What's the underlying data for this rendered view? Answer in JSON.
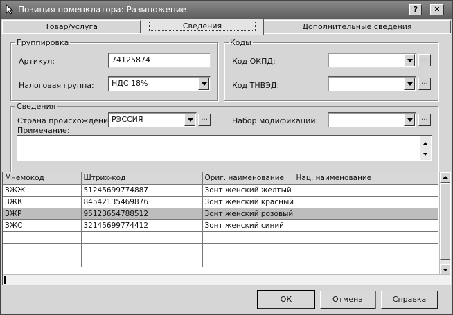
{
  "window": {
    "title": "Позиция номенклатора: Размножение",
    "help_button": "?",
    "close_button": "✕"
  },
  "tabs": [
    {
      "label": "Товар/услуга",
      "active": false
    },
    {
      "label": "Сведения",
      "active": true
    },
    {
      "label": "Дополнительные сведения",
      "active": false
    }
  ],
  "grouping": {
    "legend": "Группировка",
    "article_label": "Артикул:",
    "article_value": "74125874",
    "tax_group_label": "Налоговая группа:",
    "tax_group_value": "НДС 18%"
  },
  "codes": {
    "legend": "Коды",
    "okpd_label": "Код ОКПД:",
    "okpd_value": "",
    "tnved_label": "Код ТНВЭД:",
    "tnved_value": ""
  },
  "info": {
    "legend": "Сведения",
    "country_label": "Страна происхождения:",
    "country_value": "РЭССИЯ",
    "modifications_label": "Набор модификаций:",
    "modifications_value": "",
    "note_label": "Примечание:",
    "note_value": "",
    "ellipsis": "..."
  },
  "grid": {
    "columns": [
      "Мнемокод",
      "Штрих-код",
      "Ориг. наименование",
      "Нац. наименование",
      ""
    ],
    "rows": [
      {
        "cells": [
          "ЗЖЖ",
          "51245699774887",
          "Зонт женский желтый",
          "",
          ""
        ],
        "selected": false
      },
      {
        "cells": [
          "ЗЖК",
          "84542135469876",
          "Зонт женский красный",
          "",
          ""
        ],
        "selected": false
      },
      {
        "cells": [
          "ЗЖР",
          "95123654788512",
          "Зонт женский розовый",
          "",
          ""
        ],
        "selected": true
      },
      {
        "cells": [
          "ЗЖС",
          "32145699774412",
          "Зонт женский синий",
          "",
          ""
        ],
        "selected": false
      },
      {
        "cells": [
          "",
          "",
          "",
          "",
          ""
        ],
        "selected": false
      },
      {
        "cells": [
          "",
          "",
          "",
          "",
          ""
        ],
        "selected": false
      },
      {
        "cells": [
          "",
          "",
          "",
          "",
          ""
        ],
        "selected": false
      }
    ]
  },
  "buttons": {
    "ok": "ОК",
    "cancel": "Отмена",
    "help": "Справка"
  }
}
